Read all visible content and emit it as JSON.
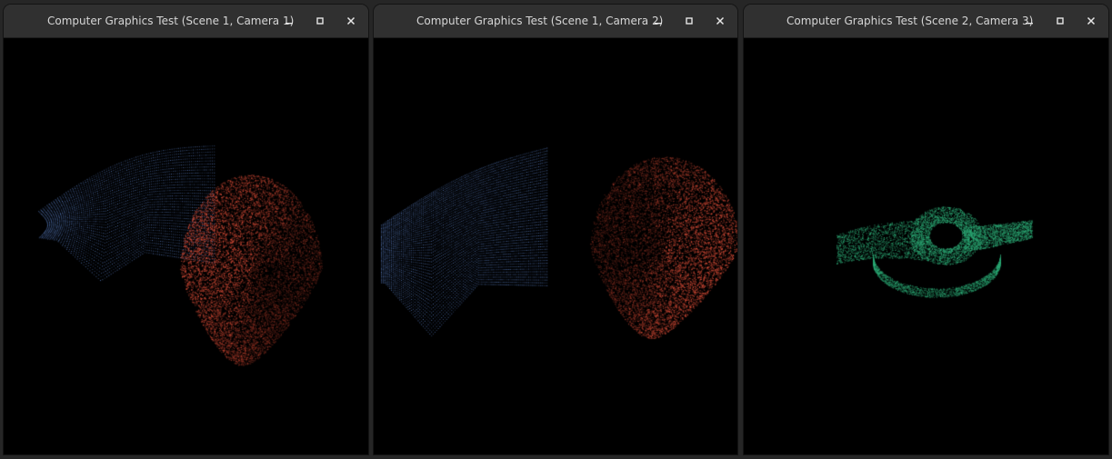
{
  "windows": [
    {
      "title": "Computer Graphics Test (Scene 1, Camera 1)",
      "icons": [
        "minimize-icon",
        "maximize-icon",
        "close-icon"
      ],
      "point_clouds": [
        {
          "name": "blue-wall-surface",
          "color": "#5c82c8"
        },
        {
          "name": "red-head-surface",
          "color": "#d04a36"
        }
      ]
    },
    {
      "title": "Computer Graphics Test (Scene 1, Camera 2)",
      "icons": [
        "minimize-icon",
        "maximize-icon",
        "close-icon"
      ],
      "point_clouds": [
        {
          "name": "blue-wall-surface",
          "color": "#5c82c8"
        },
        {
          "name": "red-head-surface",
          "color": "#d04a36"
        }
      ]
    },
    {
      "title": "Computer Graphics Test (Scene 2, Camera 3)",
      "icons": [
        "minimize-icon",
        "maximize-icon",
        "close-icon"
      ],
      "point_clouds": [
        {
          "name": "green-rocker-arm-surface",
          "color": "#2fb07a"
        }
      ]
    }
  ]
}
